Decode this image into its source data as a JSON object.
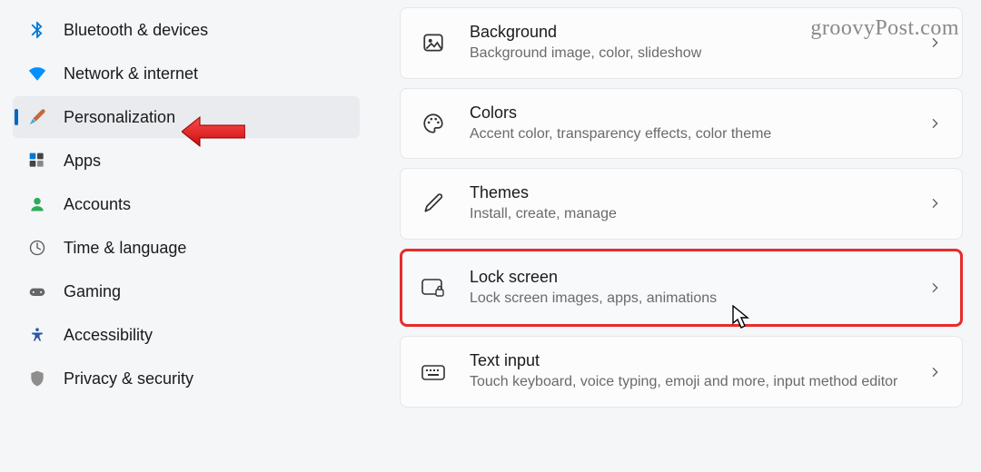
{
  "watermark": "groovyPost.com",
  "sidebar": {
    "items": [
      {
        "label": "Bluetooth & devices"
      },
      {
        "label": "Network & internet"
      },
      {
        "label": "Personalization"
      },
      {
        "label": "Apps"
      },
      {
        "label": "Accounts"
      },
      {
        "label": "Time & language"
      },
      {
        "label": "Gaming"
      },
      {
        "label": "Accessibility"
      },
      {
        "label": "Privacy & security"
      }
    ]
  },
  "cards": [
    {
      "title": "Background",
      "desc": "Background image, color, slideshow"
    },
    {
      "title": "Colors",
      "desc": "Accent color, transparency effects, color theme"
    },
    {
      "title": "Themes",
      "desc": "Install, create, manage"
    },
    {
      "title": "Lock screen",
      "desc": "Lock screen images, apps, animations"
    },
    {
      "title": "Text input",
      "desc": "Touch keyboard, voice typing, emoji and more, input method editor"
    }
  ]
}
